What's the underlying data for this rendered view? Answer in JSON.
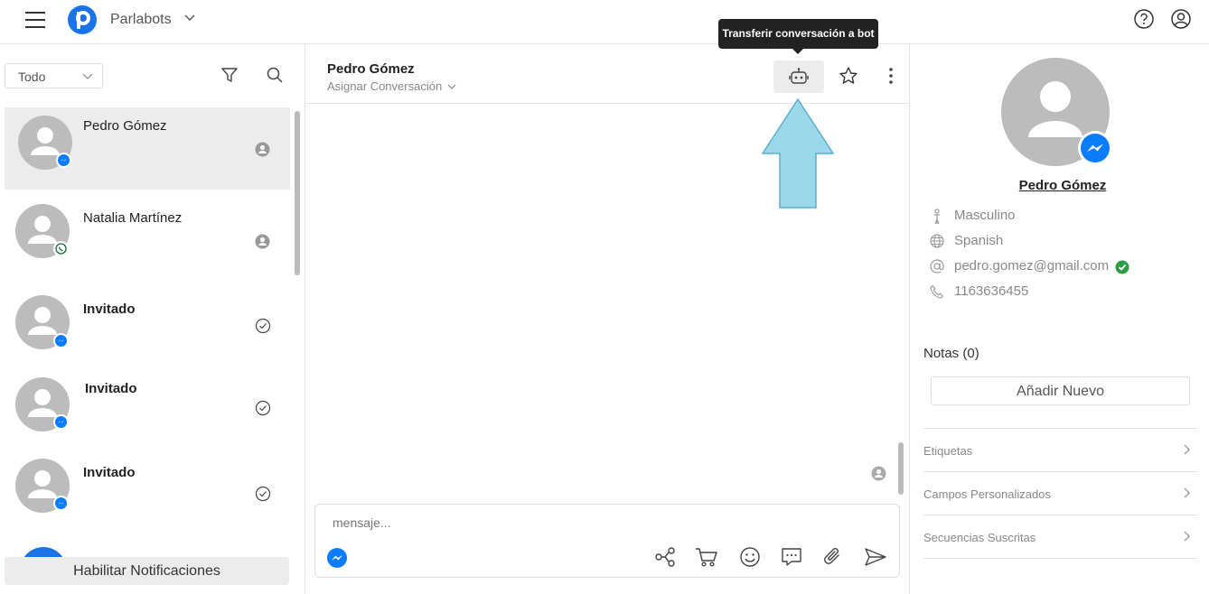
{
  "header": {
    "brand": "Parlabots"
  },
  "left": {
    "filter_value": "Todo",
    "conversations": [
      {
        "name": "Pedro Gómez",
        "channel": "messenger-icon",
        "status": "user-icon",
        "bold": false
      },
      {
        "name": "Natalia Martínez",
        "channel": "whatsapp-icon",
        "status": "user-icon",
        "bold": false
      },
      {
        "name": "Invitado",
        "channel": "messenger-icon",
        "status": "check-circle-icon",
        "bold": true
      },
      {
        "name": "Invitado",
        "channel": "messenger-icon",
        "status": "check-circle-icon",
        "bold": true
      },
      {
        "name": "Invitado",
        "channel": "messenger-icon",
        "status": "check-circle-icon",
        "bold": true
      }
    ],
    "notifications_button": "Habilitar Notificaciones"
  },
  "chat": {
    "contact_name": "Pedro Gómez",
    "assign_label": "Asignar Conversación",
    "tooltip": "Transferir conversación a bot",
    "composer_placeholder": "mensaje..."
  },
  "profile": {
    "name": "Pedro Gómez",
    "gender": "Masculino",
    "language": "Spanish",
    "email": "pedro.gomez@gmail.com",
    "phone": "1163636455",
    "notes_title": "Notas (0)",
    "add_button": "Añadir Nuevo",
    "sections": [
      "Etiquetas",
      "Campos Personalizados",
      "Secuencias Suscritas"
    ]
  },
  "colors": {
    "brand": "#1a73e8",
    "messenger": "#0a7cff",
    "verified": "#2e9e44",
    "arrow": "#9ad8ea"
  }
}
